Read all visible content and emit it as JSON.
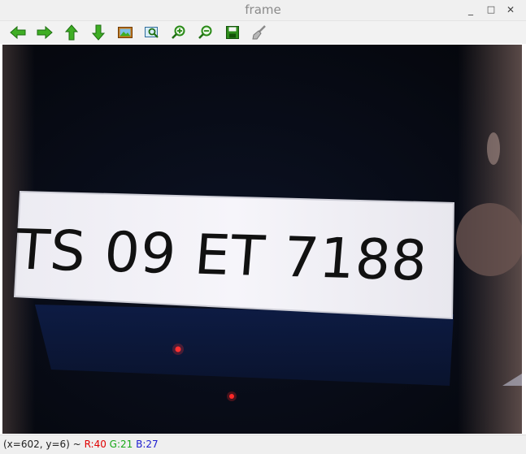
{
  "window": {
    "title": "frame"
  },
  "window_controls": {
    "minimize": "_",
    "maximize": "□",
    "close": "✕"
  },
  "toolbar": {
    "buttons": [
      {
        "name": "pan-left",
        "icon": "arrow-left-icon"
      },
      {
        "name": "pan-right",
        "icon": "arrow-right-icon"
      },
      {
        "name": "pan-up",
        "icon": "arrow-up-icon"
      },
      {
        "name": "pan-down",
        "icon": "arrow-down-icon"
      },
      {
        "name": "zoom-fit",
        "icon": "image-icon"
      },
      {
        "name": "zoom-original",
        "icon": "zoom-area-icon"
      },
      {
        "name": "zoom-in",
        "icon": "zoom-in-icon"
      },
      {
        "name": "zoom-out",
        "icon": "zoom-out-icon"
      },
      {
        "name": "save",
        "icon": "save-icon"
      },
      {
        "name": "properties",
        "icon": "brush-icon"
      }
    ]
  },
  "image": {
    "plate_text": "TS 09 ET 7188"
  },
  "status": {
    "coords": "(x=602, y=6)",
    "sep": "~",
    "r": "R:40",
    "g": "G:21",
    "b": "B:27"
  },
  "colors": {
    "icon_green": "#3fae24",
    "icon_dark": "#1f6f12",
    "r": "#e00000",
    "g": "#18a818",
    "b": "#1c1cd0"
  }
}
